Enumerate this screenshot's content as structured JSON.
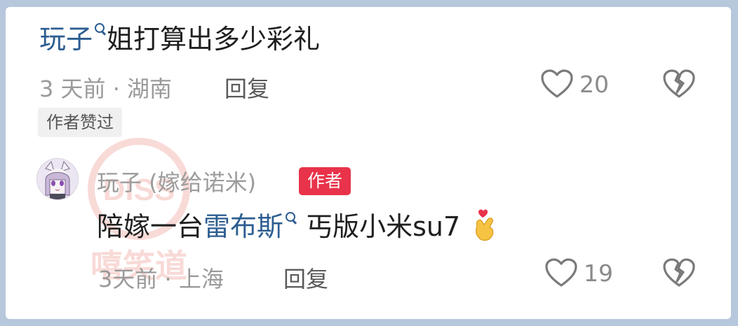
{
  "comment1": {
    "username": "玩子",
    "text": "姐打算出多少彩礼",
    "meta": "3 天前 · 湖南",
    "reply_label": "回复",
    "like_count": "20",
    "author_liked_badge": "作者赞过"
  },
  "comment2": {
    "username": "玩子 (嫁给诺米)",
    "author_badge": "作者",
    "text_before": "陪嫁一台",
    "link_text": "雷布斯",
    "text_after": " 丐版小米su7",
    "meta": "3天前 · 上海",
    "reply_label": "回复",
    "like_count": "19"
  },
  "watermark": {
    "logo_text": "DISS",
    "caption": "嘻笑道"
  },
  "colors": {
    "link": "#2c5d91",
    "author_badge": "#e8334a",
    "meta": "#9a9a9a"
  },
  "icons": [
    "search-icon",
    "heart-outline-icon",
    "broken-heart-icon",
    "finger-heart-emoji",
    "avatar-anime-girl"
  ]
}
